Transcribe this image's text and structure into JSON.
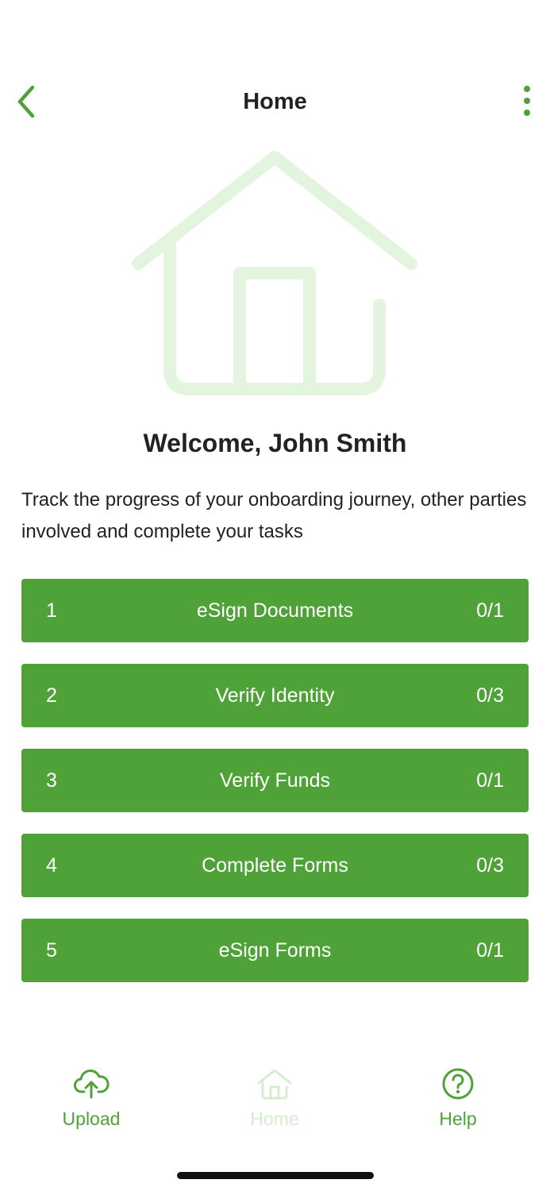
{
  "header": {
    "title": "Home",
    "back_icon": "chevron-left-icon",
    "menu_icon": "more-vertical-icon"
  },
  "hero": {
    "icon": "house-illustration"
  },
  "welcome": {
    "title": "Welcome, John Smith",
    "description": "Track the progress of your onboarding journey, other parties involved and complete your tasks"
  },
  "tasks": [
    {
      "number": "1",
      "label": "eSign Documents",
      "progress": "0/1"
    },
    {
      "number": "2",
      "label": "Verify Identity",
      "progress": "0/3"
    },
    {
      "number": "3",
      "label": "Verify Funds",
      "progress": "0/1"
    },
    {
      "number": "4",
      "label": "Complete Forms",
      "progress": "0/3"
    },
    {
      "number": "5",
      "label": "eSign Forms",
      "progress": "0/1"
    }
  ],
  "bottom_nav": {
    "items": [
      {
        "label": "Upload",
        "icon": "cloud-upload-icon",
        "active": false
      },
      {
        "label": "Home",
        "icon": "home-icon",
        "active": true
      },
      {
        "label": "Help",
        "icon": "help-circle-icon",
        "active": false
      }
    ]
  },
  "colors": {
    "accent": "#4fa237",
    "accent_light": "#e3f5df",
    "text": "#222222"
  }
}
